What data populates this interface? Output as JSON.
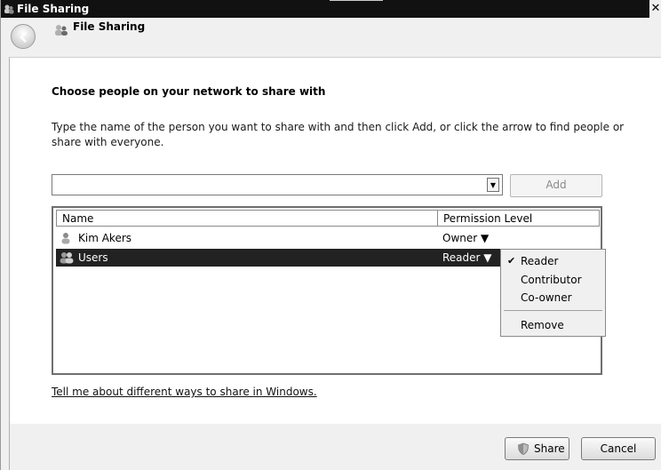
{
  "window": {
    "title": "File Sharing",
    "close_glyph": "✕"
  },
  "nav": {
    "title": "File Sharing",
    "back_icon": "back-arrow-icon"
  },
  "main": {
    "heading": "Choose people on your network to share with",
    "instructions": "Type the name of the person you want to share with and then click Add, or click the arrow to find people or share with everyone.",
    "name_input": {
      "value": "",
      "placeholder": ""
    },
    "add_label": "Add",
    "columns": [
      "Name",
      "Permission Level"
    ],
    "rows": [
      {
        "name": "Kim Akers",
        "permission": "Owner",
        "icon": "user-icon",
        "selected": false
      },
      {
        "name": "Users",
        "permission": "Reader",
        "icon": "group-icon",
        "selected": true
      }
    ],
    "permission_menu": {
      "items": [
        {
          "label": "Reader",
          "checked": true
        },
        {
          "label": "Contributor",
          "checked": false
        },
        {
          "label": "Co-owner",
          "checked": false
        }
      ],
      "remove_label": "Remove"
    },
    "help_link": "Tell me about different ways to share in Windows."
  },
  "footer": {
    "share_label": "Share",
    "cancel_label": "Cancel"
  }
}
